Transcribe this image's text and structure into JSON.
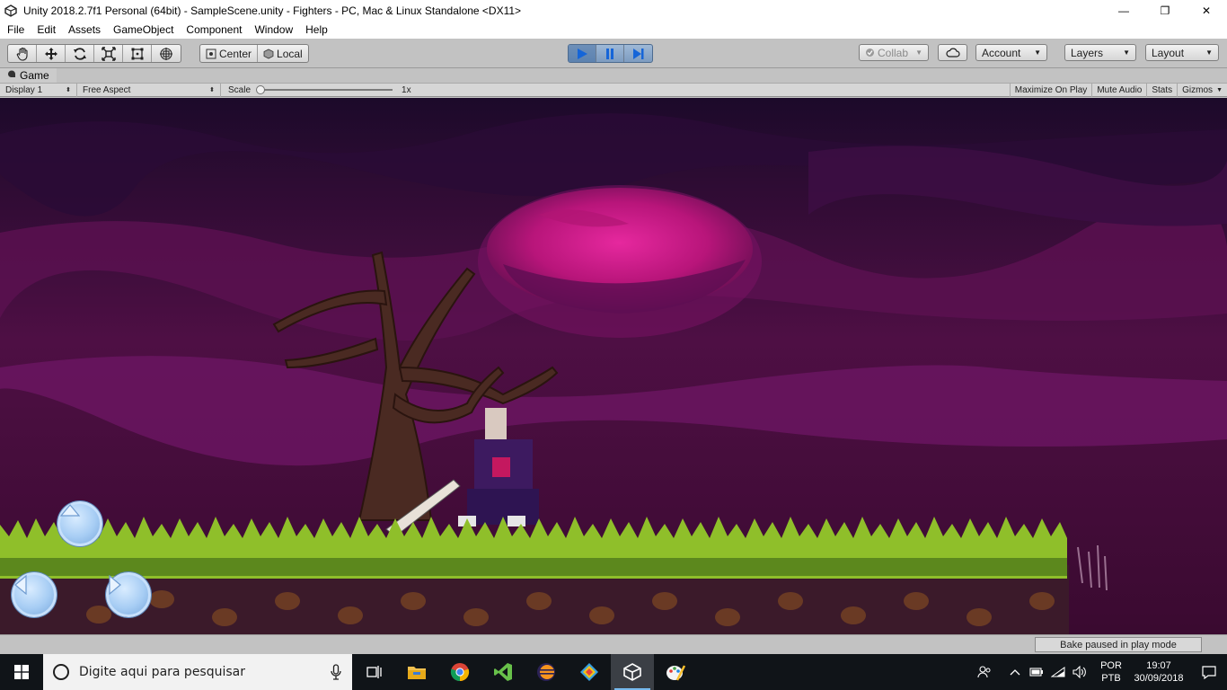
{
  "window": {
    "title": "Unity 2018.2.7f1 Personal (64bit) - SampleScene.unity - Fighters - PC, Mac & Linux Standalone <DX11>",
    "minimize": "—",
    "maximize": "❐",
    "close": "✕"
  },
  "menu": [
    "File",
    "Edit",
    "Assets",
    "GameObject",
    "Component",
    "Window",
    "Help"
  ],
  "toolbar": {
    "tools": [
      "hand-icon",
      "move-icon",
      "rotate-icon",
      "scale-icon",
      "rect-icon",
      "transform-icon"
    ],
    "pivot_center": "Center",
    "pivot_local": "Local",
    "collab": "Collab",
    "account": "Account",
    "layers": "Layers",
    "layout": "Layout"
  },
  "game_panel": {
    "tab_label": "Game",
    "display": "Display 1",
    "aspect": "Free Aspect",
    "scale_label": "Scale",
    "scale_value": "1x",
    "maximize_on_play": "Maximize On Play",
    "mute_audio": "Mute Audio",
    "stats": "Stats",
    "gizmos": "Gizmos"
  },
  "status": {
    "bake": "Bake paused in play mode"
  },
  "taskbar": {
    "search_placeholder": "Digite aqui para pesquisar",
    "apps": [
      "task-view-icon",
      "file-explorer-icon",
      "chrome-icon",
      "visual-studio-icon",
      "eclipse-icon",
      "git-icon",
      "unity-icon",
      "paint-icon"
    ],
    "language_line1": "POR",
    "language_line2": "PTB",
    "time": "19:07",
    "date": "30/09/2018"
  },
  "colors": {
    "sky": "#3a0a2e",
    "moon": "#d0188c",
    "grass": "#8fbf2a",
    "ground": "#3b1a2a",
    "play_accent": "#5c82b0"
  }
}
